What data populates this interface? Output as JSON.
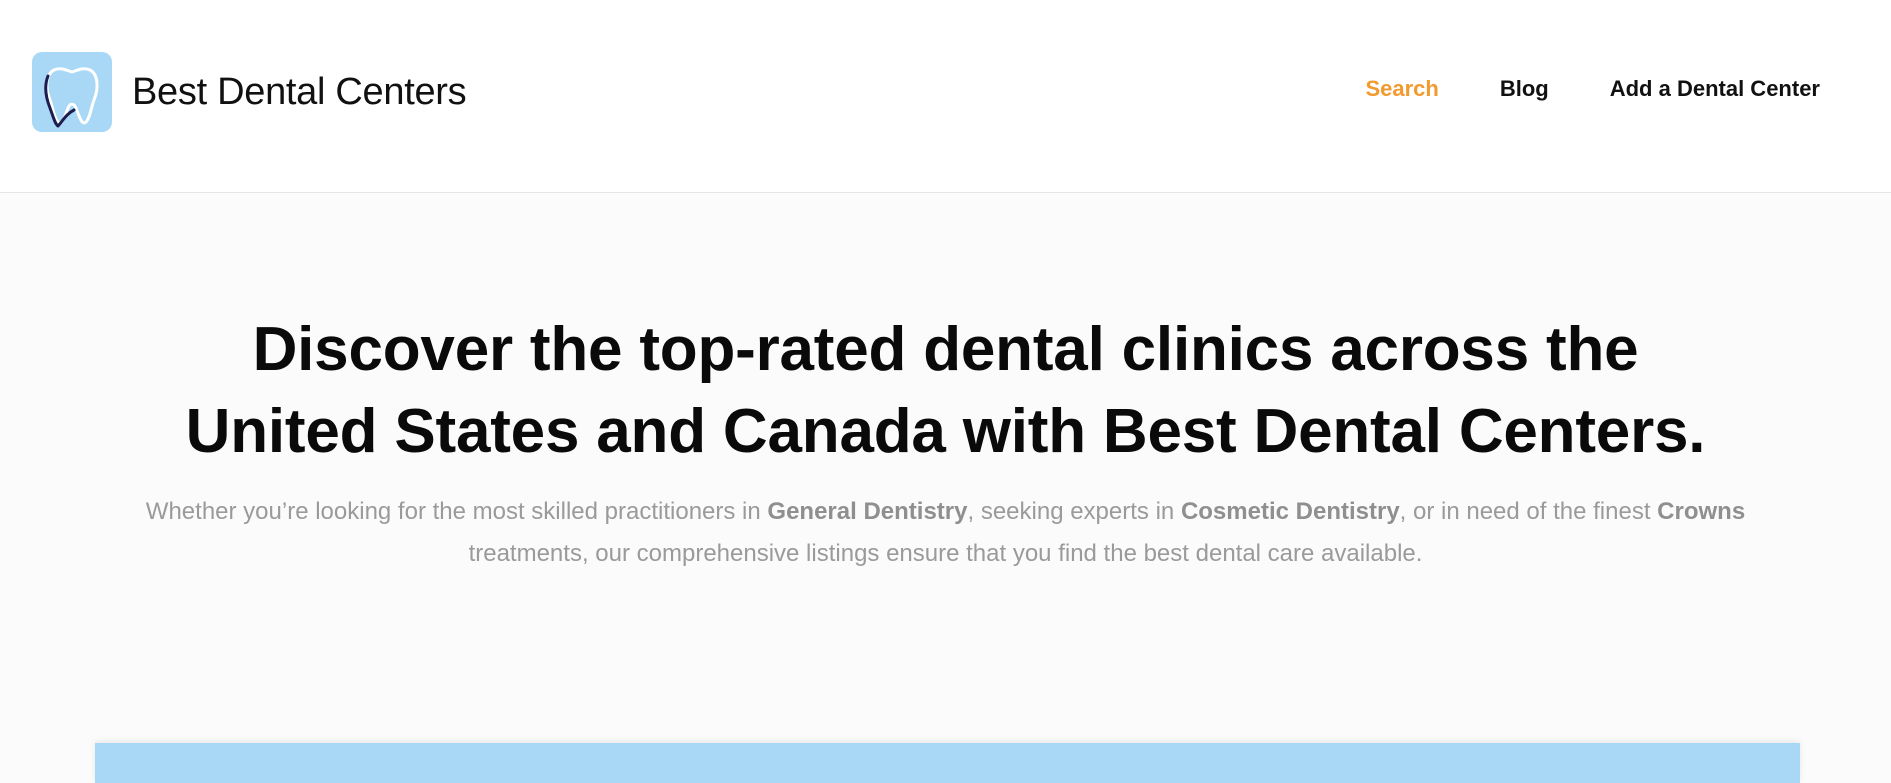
{
  "brand": {
    "name_light": "Best",
    "name_bold": "Dental Centers",
    "logo_icon": "tooth-icon",
    "logo_bg_color": "#a8d8f6"
  },
  "nav": {
    "items": [
      {
        "label": "Search",
        "active": true
      },
      {
        "label": "Blog",
        "active": false
      },
      {
        "label": "Add a Dental Center",
        "active": false
      }
    ],
    "active_color": "#f39a2e"
  },
  "hero": {
    "title_line1": "Discover the top-rated dental clinics across the",
    "title_line2": "United States and Canada with Best Dental Centers.",
    "sub_part1": "Whether you’re looking for the most skilled practitioners in ",
    "sub_bold1": "General Dentistry",
    "sub_part2": ", seeking experts in ",
    "sub_bold2": "Cosmetic Dentistry",
    "sub_part3": ", or in need of the finest ",
    "sub_bold3": "Crowns",
    "sub_part4": " treatments, our comprehensive listings ensure that you find the best dental care available."
  }
}
